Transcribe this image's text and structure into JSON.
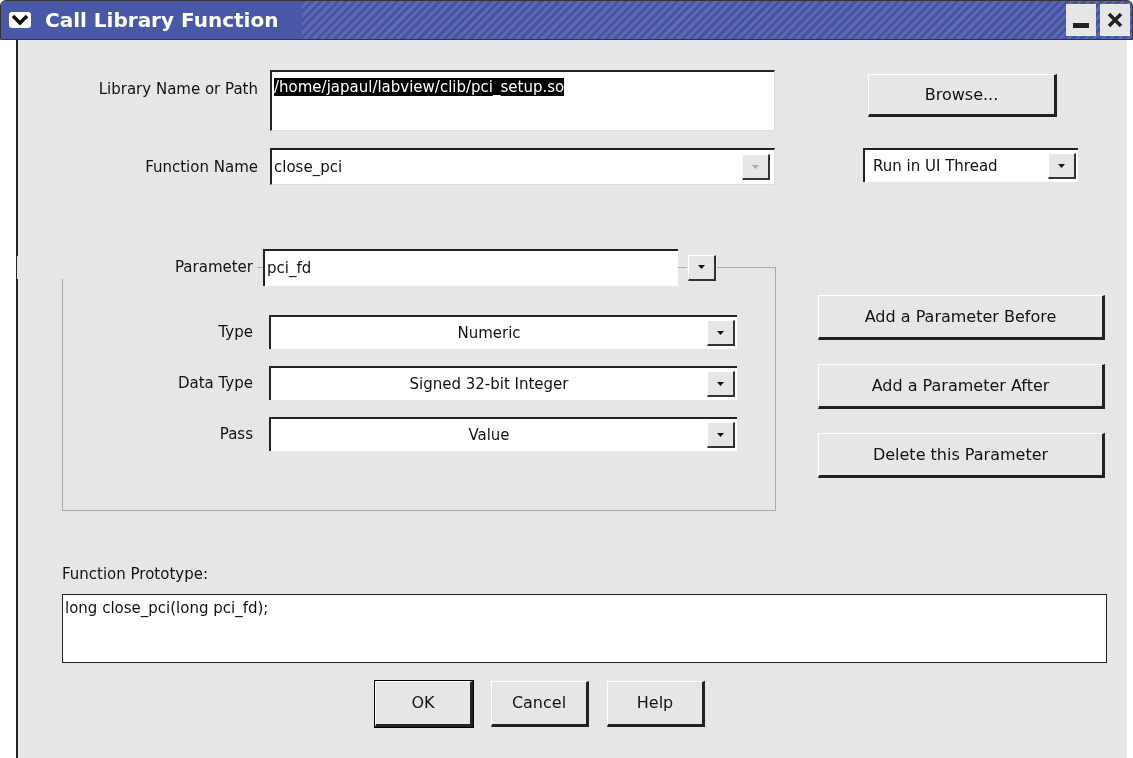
{
  "window": {
    "title": "Call Library Function"
  },
  "library": {
    "label": "Library Name or Path",
    "value": "/home/japaul/labview/clib/pci_setup.so",
    "selected": true
  },
  "function_name": {
    "label": "Function Name",
    "value": "close_pci",
    "disabled": true
  },
  "browse_button": "Browse...",
  "thread": {
    "value": "Run in UI Thread"
  },
  "parameter": {
    "label": "Parameter",
    "value": "pci_fd"
  },
  "parameter_fields": [
    {
      "label": "Type",
      "value": "Numeric"
    },
    {
      "label": "Data Type",
      "value": "Signed 32-bit Integer"
    },
    {
      "label": "Pass",
      "value": "Value"
    }
  ],
  "parameter_buttons": [
    "Add a Parameter Before",
    "Add a Parameter After",
    "Delete this Parameter"
  ],
  "prototype": {
    "label": "Function Prototype:",
    "value": "long close_pci(long pci_fd);"
  },
  "buttons": [
    {
      "label": "OK",
      "default": true
    },
    {
      "label": "Cancel",
      "default": false
    },
    {
      "label": "Help",
      "default": false
    }
  ]
}
